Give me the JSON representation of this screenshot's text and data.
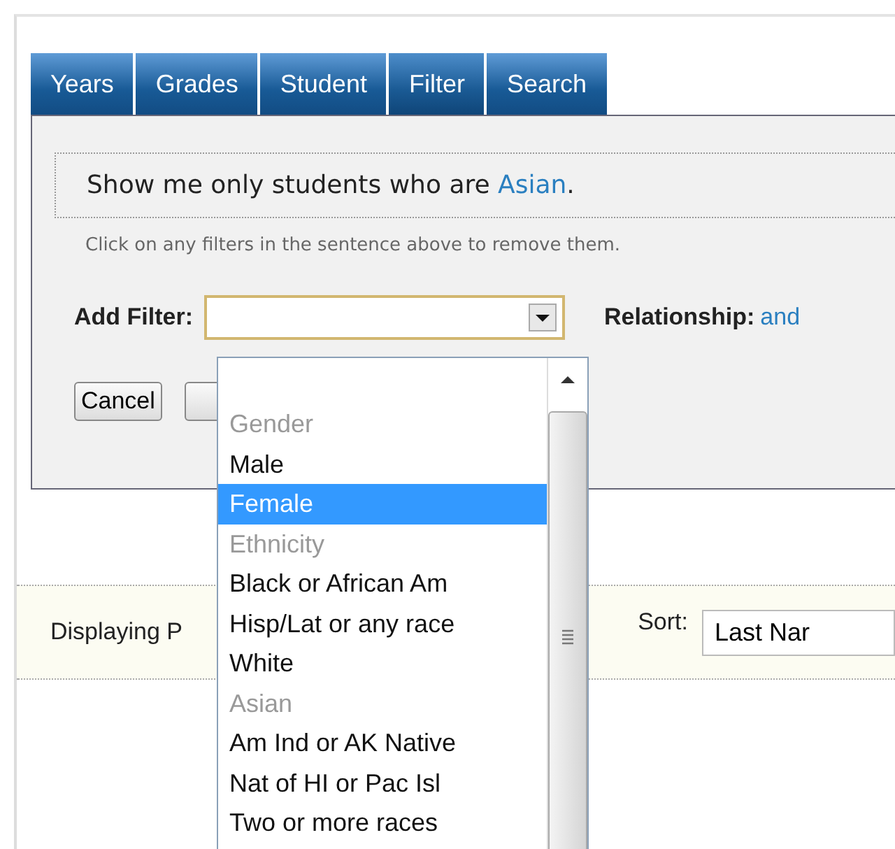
{
  "tabs": [
    {
      "label": "Years",
      "selected": false
    },
    {
      "label": "Grades",
      "selected": false
    },
    {
      "label": "Student",
      "selected": false
    },
    {
      "label": "Filter",
      "selected": true
    },
    {
      "label": "Search",
      "selected": false
    }
  ],
  "sentence": {
    "prefix": "Show me only students who are ",
    "filter_link": "Asian",
    "suffix": "."
  },
  "hint": "Click on any filters in the sentence above to remove them.",
  "add_filter": {
    "label": "Add Filter:",
    "expanded": true
  },
  "relationship": {
    "label": "Relationship:",
    "value": "and"
  },
  "buttons": [
    "Cancel"
  ],
  "dropdown_options": [
    {
      "kind": "group",
      "label": "Gender"
    },
    {
      "kind": "option",
      "label": "Male",
      "selected": false,
      "disabled": false
    },
    {
      "kind": "option",
      "label": "Female",
      "selected": true,
      "disabled": false
    },
    {
      "kind": "group",
      "label": "Ethnicity"
    },
    {
      "kind": "option",
      "label": "Black or African Am",
      "selected": false,
      "disabled": false
    },
    {
      "kind": "option",
      "label": "Hisp/Lat or any race",
      "selected": false,
      "disabled": false
    },
    {
      "kind": "option",
      "label": "White",
      "selected": false,
      "disabled": false
    },
    {
      "kind": "option",
      "label": "Asian",
      "selected": false,
      "disabled": true
    },
    {
      "kind": "option",
      "label": "Am Ind or AK Native",
      "selected": false,
      "disabled": false
    },
    {
      "kind": "option",
      "label": "Nat of HI or Pac Isl",
      "selected": false,
      "disabled": false
    },
    {
      "kind": "option",
      "label": "Two or more races",
      "selected": false,
      "disabled": false
    }
  ],
  "results_bar": {
    "status": "Displaying P",
    "sort_label": "Sort:",
    "sort_value": "Last Nar"
  }
}
